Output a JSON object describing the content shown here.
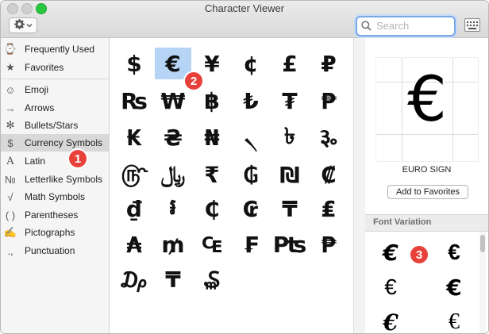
{
  "window": {
    "title": "Character Viewer"
  },
  "toolbar": {
    "gear_icon": "gear-icon",
    "search_placeholder": "Search"
  },
  "sidebar": {
    "items": [
      {
        "label": "Frequently Used",
        "icon": "⌚"
      },
      {
        "label": "Favorites",
        "icon": "★"
      },
      {
        "label": "Emoji",
        "icon": "☺"
      },
      {
        "label": "Arrows",
        "icon": "→"
      },
      {
        "label": "Bullets/Stars",
        "icon": "✻"
      },
      {
        "label": "Currency Symbols",
        "icon": "$"
      },
      {
        "label": "Latin",
        "icon": "A"
      },
      {
        "label": "Letterlike Symbols",
        "icon": "№"
      },
      {
        "label": "Math Symbols",
        "icon": "√"
      },
      {
        "label": "Parentheses",
        "icon": "( )"
      },
      {
        "label": "Pictographs",
        "icon": "✍"
      },
      {
        "label": "Punctuation",
        "icon": ".,"
      }
    ]
  },
  "grid": {
    "chars": [
      "$",
      "€",
      "¥",
      "¢",
      "£",
      "₽",
      "₨",
      "₩",
      "฿",
      "₺",
      "₮",
      "₱",
      "₭",
      "₴",
      "₦",
      "৲",
      "৳",
      "૱",
      "௹",
      "﷼",
      "₹",
      "₲",
      "₪",
      "₡",
      "₫",
      "៛",
      "₵",
      "₢",
      "₸",
      "₤",
      "₳",
      "₥",
      "₠",
      "₣",
      "₧",
      "₱",
      "₯",
      "₸",
      "₷"
    ]
  },
  "detail": {
    "preview_glyph": "€",
    "char_name": "EURO SIGN",
    "add_favorites_label": "Add to Favorites",
    "font_variation_title": "Font Variation",
    "variations": [
      "€",
      "€",
      "€",
      "€",
      "€",
      "€"
    ]
  },
  "badges": [
    "1",
    "2",
    "3"
  ]
}
